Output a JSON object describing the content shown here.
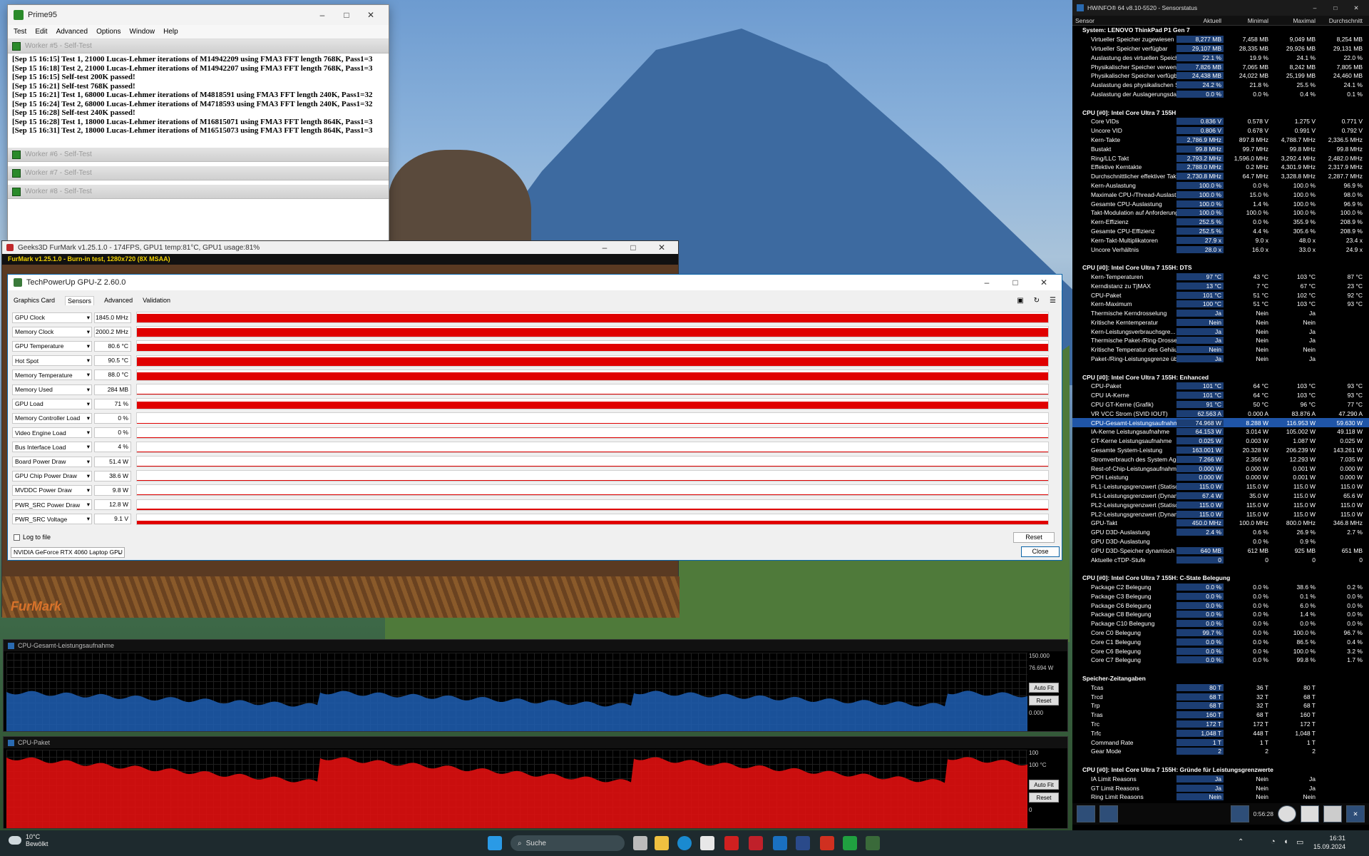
{
  "prime95": {
    "title": "Prime95",
    "menu": [
      "Test",
      "Edit",
      "Advanced",
      "Options",
      "Window",
      "Help"
    ],
    "worker5": "Worker #5 - Self-Test",
    "log": [
      "[Sep 15 16:15] Test 1, 21000 Lucas-Lehmer iterations of M14942209 using FMA3 FFT length 768K, Pass1=3",
      "[Sep 15 16:18] Test 2, 21000 Lucas-Lehmer iterations of M14942207 using FMA3 FFT length 768K, Pass1=3",
      "[Sep 15 16:15] Self-test 200K passed!",
      "[Sep 15 16:21] Self-test 768K passed!",
      "[Sep 15 16:21] Test 1, 68000 Lucas-Lehmer iterations of M4818591 using FMA3 FFT length 240K, Pass1=32",
      "[Sep 15 16:24] Test 2, 68000 Lucas-Lehmer iterations of M4718593 using FMA3 FFT length 240K, Pass1=32",
      "[Sep 15 16:28] Self-test 240K passed!",
      "[Sep 15 16:28] Test 1, 18000 Lucas-Lehmer iterations of M16815071 using FMA3 FFT length 864K, Pass1=3",
      "[Sep 15 16:31] Test 2, 18000 Lucas-Lehmer iterations of M16515073 using FMA3 FFT length 864K, Pass1=3"
    ],
    "workers": [
      "Worker #6 - Self-Test",
      "Worker #7 - Self-Test",
      "Worker #8 - Self-Test"
    ]
  },
  "furmark": {
    "title": "Geeks3D FurMark v1.25.1.0 - 174FPS, GPU1 temp:81°C, GPU1 usage:81%",
    "banner": "FurMark v1.25.1.0 - Burn-in test, 1280x720 (8X MSAA)",
    "logo": "FurMark"
  },
  "gpuz": {
    "title": "TechPowerUp GPU-Z 2.60.0",
    "tabs": [
      "Graphics Card",
      "Sensors",
      "Advanced",
      "Validation"
    ],
    "sensors": [
      {
        "name": "GPU Clock",
        "value": "1845.0 MHz",
        "level": 0.85
      },
      {
        "name": "Memory Clock",
        "value": "2000.2 MHz",
        "level": 0.85
      },
      {
        "name": "GPU Temperature",
        "value": "80.6 °C",
        "level": 0.75
      },
      {
        "name": "Hot Spot",
        "value": "90.5 °C",
        "level": 0.8
      },
      {
        "name": "Memory Temperature",
        "value": "88.0 °C",
        "level": 0.8
      },
      {
        "name": "Memory Used",
        "value": "284 MB",
        "level": 0.0
      },
      {
        "name": "GPU Load",
        "value": "71 %",
        "level": 0.7
      },
      {
        "name": "Memory Controller Load",
        "value": "0 %",
        "level": 0.0
      },
      {
        "name": "Video Engine Load",
        "value": "0 %",
        "level": 0.0
      },
      {
        "name": "Bus Interface Load",
        "value": "4 %",
        "level": 0.05
      },
      {
        "name": "Board Power Draw",
        "value": "51.4 W",
        "level": 0.1
      },
      {
        "name": "GPU Chip Power Draw",
        "value": "38.6 W",
        "level": 0.1
      },
      {
        "name": "MVDDC Power Draw",
        "value": "9.8 W",
        "level": 0.08
      },
      {
        "name": "PWR_SRC Power Draw",
        "value": "12.8 W",
        "level": 0.1
      },
      {
        "name": "PWR_SRC Voltage",
        "value": "9.1 V",
        "level": 0.35
      }
    ],
    "log_to_file": "Log to file",
    "reset": "Reset",
    "close": "Close",
    "gpu_select": "NVIDIA GeForce RTX 4060 Laptop GPU"
  },
  "hwinfo": {
    "title": "HWiNFO® 64 v8.10-5520 - Sensorstatus",
    "columns": [
      "Sensor",
      "Aktuell",
      "Minimal",
      "Maximal",
      "Durchschnitt"
    ],
    "rows": [
      {
        "type": "grp",
        "name": "System: LENOVO ThinkPad P1 Gen 7"
      },
      {
        "name": "Virtueller Speicher zugewiesen",
        "v": [
          "8,277 MB",
          "7,458 MB",
          "9,049 MB",
          "8,254 MB"
        ]
      },
      {
        "name": "Virtueller Speicher verfügbar",
        "v": [
          "29,107 MB",
          "28,335 MB",
          "29,926 MB",
          "29,131 MB"
        ]
      },
      {
        "name": "Auslastung des virtuellen Speichers",
        "v": [
          "22.1 %",
          "19.9 %",
          "24.1 %",
          "22.0 %"
        ]
      },
      {
        "name": "Physikalischer Speicher verwendet",
        "v": [
          "7,826 MB",
          "7,065 MB",
          "8,242 MB",
          "7,805 MB"
        ]
      },
      {
        "name": "Physikalischer Speicher verfügbar",
        "v": [
          "24,438 MB",
          "24,022 MB",
          "25,199 MB",
          "24,460 MB"
        ]
      },
      {
        "name": "Auslastung des physikalischen Sp...",
        "v": [
          "24.2 %",
          "21.8 %",
          "25.5 %",
          "24.1 %"
        ]
      },
      {
        "name": "Auslastung der Auslagerungsdatei",
        "v": [
          "0.0 %",
          "0.0 %",
          "0.4 %",
          "0.1 %"
        ]
      },
      {
        "type": "space"
      },
      {
        "type": "grp",
        "name": "CPU [#0]: Intel Core Ultra 7 155H"
      },
      {
        "name": "Core VIDs",
        "v": [
          "0.836 V",
          "0.578 V",
          "1.275 V",
          "0.771 V"
        ]
      },
      {
        "name": "Uncore VID",
        "v": [
          "0.806 V",
          "0.678 V",
          "0.991 V",
          "0.792 V"
        ]
      },
      {
        "name": "Kern-Takte",
        "v": [
          "2,786.9 MHz",
          "897.8 MHz",
          "4,788.7 MHz",
          "2,336.5 MHz"
        ]
      },
      {
        "name": "Bustakt",
        "v": [
          "99.8 MHz",
          "99.7 MHz",
          "99.8 MHz",
          "99.8 MHz"
        ]
      },
      {
        "name": "Ring/LLC Takt",
        "v": [
          "2,793.2 MHz",
          "1,596.0 MHz",
          "3,292.4 MHz",
          "2,482.0 MHz"
        ]
      },
      {
        "name": "Effektive Kerntakte",
        "v": [
          "2,788.0 MHz",
          "0.2 MHz",
          "4,301.9 MHz",
          "2,317.9 MHz"
        ]
      },
      {
        "name": "Durchschnittlicher effektiver Takt",
        "v": [
          "2,730.8 MHz",
          "64.7 MHz",
          "3,328.8 MHz",
          "2,287.7 MHz"
        ]
      },
      {
        "name": "Kern-Auslastung",
        "v": [
          "100.0 %",
          "0.0 %",
          "100.0 %",
          "96.9 %"
        ]
      },
      {
        "name": "Maximale CPU-/Thread-Auslastung",
        "v": [
          "100.0 %",
          "15.0 %",
          "100.0 %",
          "98.0 %"
        ]
      },
      {
        "name": "Gesamte CPU-Auslastung",
        "v": [
          "100.0 %",
          "1.4 %",
          "100.0 %",
          "96.9 %"
        ]
      },
      {
        "name": "Takt-Modulation auf Anforderung",
        "v": [
          "100.0 %",
          "100.0 %",
          "100.0 %",
          "100.0 %"
        ]
      },
      {
        "name": "Kern-Effizienz",
        "v": [
          "252.5 %",
          "0.0 %",
          "355.9 %",
          "208.9 %"
        ]
      },
      {
        "name": "Gesamte CPU-Effizienz",
        "v": [
          "252.5 %",
          "4.4 %",
          "305.6 %",
          "208.9 %"
        ]
      },
      {
        "name": "Kern-Takt-Multiplikatoren",
        "v": [
          "27.9 x",
          "9.0 x",
          "48.0 x",
          "23.4 x"
        ]
      },
      {
        "name": "Uncore Verhältnis",
        "v": [
          "28.0 x",
          "16.0 x",
          "33.0 x",
          "24.9 x"
        ]
      },
      {
        "type": "space"
      },
      {
        "type": "grp",
        "name": "CPU [#0]: Intel Core Ultra 7 155H: DTS"
      },
      {
        "name": "Kern-Temperaturen",
        "v": [
          "97 °C",
          "43 °C",
          "103 °C",
          "87 °C"
        ]
      },
      {
        "name": "Kerndistanz zu TjMAX",
        "v": [
          "13 °C",
          "7 °C",
          "67 °C",
          "23 °C"
        ]
      },
      {
        "name": "CPU-Paket",
        "v": [
          "101 °C",
          "51 °C",
          "102 °C",
          "92 °C"
        ]
      },
      {
        "name": "Kern-Maximum",
        "v": [
          "100 °C",
          "51 °C",
          "103 °C",
          "93 °C"
        ]
      },
      {
        "name": "Thermische Kerndrosselung",
        "v": [
          "Ja",
          "Nein",
          "Ja",
          ""
        ]
      },
      {
        "name": "Kritische Kerntemperatur",
        "v": [
          "Nein",
          "Nein",
          "Nein",
          ""
        ]
      },
      {
        "name": "Kern-Leistungsverbrauchsgre...",
        "v": [
          "Ja",
          "Nein",
          "Ja",
          ""
        ]
      },
      {
        "name": "Thermische Paket-/Ring-Drosselung",
        "v": [
          "Ja",
          "Nein",
          "Ja",
          ""
        ]
      },
      {
        "name": "Kritische Temperatur des Gehäus...",
        "v": [
          "Nein",
          "Nein",
          "Nein",
          ""
        ]
      },
      {
        "name": "Paket-/Ring-Leistungsgrenze übe...",
        "v": [
          "Ja",
          "Nein",
          "Ja",
          ""
        ]
      },
      {
        "type": "space"
      },
      {
        "type": "grp",
        "name": "CPU [#0]: Intel Core Ultra 7 155H: Enhanced"
      },
      {
        "name": "CPU-Paket",
        "v": [
          "101 °C",
          "64 °C",
          "103 °C",
          "93 °C"
        ]
      },
      {
        "name": "CPU IA-Kerne",
        "v": [
          "101 °C",
          "64 °C",
          "103 °C",
          "93 °C"
        ]
      },
      {
        "name": "CPU GT-Kerne (Grafik)",
        "v": [
          "91 °C",
          "50 °C",
          "96 °C",
          "77 °C"
        ]
      },
      {
        "name": "VR VCC Strom (SVID IOUT)",
        "v": [
          "62.563 A",
          "0.000 A",
          "83.876 A",
          "47.290 A"
        ]
      },
      {
        "type": "sel",
        "name": "CPU-Gesamt-Leistungsaufnahme",
        "v": [
          "74.968 W",
          "8.288 W",
          "116.953 W",
          "59.630 W"
        ]
      },
      {
        "name": "IA-Kerne Leistungsaufnahme",
        "v": [
          "64.153 W",
          "3.014 W",
          "105.002 W",
          "49.118 W"
        ]
      },
      {
        "name": "GT-Kerne Leistungsaufnahme",
        "v": [
          "0.025 W",
          "0.003 W",
          "1.087 W",
          "0.025 W"
        ]
      },
      {
        "name": "Gesamte System-Leistung",
        "v": [
          "163.001 W",
          "20.328 W",
          "206.239 W",
          "143.261 W"
        ]
      },
      {
        "name": "Stromverbrauch des System Agent",
        "v": [
          "7.266 W",
          "2.356 W",
          "12.293 W",
          "7.035 W"
        ]
      },
      {
        "name": "Rest-of-Chip-Leistungsaufnahme",
        "v": [
          "0.000 W",
          "0.000 W",
          "0.001 W",
          "0.000 W"
        ]
      },
      {
        "name": "PCH Leistung",
        "v": [
          "0.000 W",
          "0.000 W",
          "0.001 W",
          "0.000 W"
        ]
      },
      {
        "name": "PL1-Leistungsgrenzwert (Statisch)",
        "v": [
          "115.0 W",
          "115.0 W",
          "115.0 W",
          "115.0 W"
        ]
      },
      {
        "name": "PL1-Leistungsgrenzwert (Dynami...",
        "v": [
          "67.4 W",
          "35.0 W",
          "115.0 W",
          "65.6 W"
        ]
      },
      {
        "name": "PL2-Leistungsgrenzwert (Statisch)",
        "v": [
          "115.0 W",
          "115.0 W",
          "115.0 W",
          "115.0 W"
        ]
      },
      {
        "name": "PL2-Leistungsgrenzwert (Dynami...",
        "v": [
          "115.0 W",
          "115.0 W",
          "115.0 W",
          "115.0 W"
        ]
      },
      {
        "name": "GPU-Takt",
        "v": [
          "450.0 MHz",
          "100.0 MHz",
          "800.0 MHz",
          "346.8 MHz"
        ]
      },
      {
        "name": "GPU D3D-Auslastung",
        "v": [
          "2.4 %",
          "0.6 %",
          "26.9 %",
          "2.7 %"
        ]
      },
      {
        "name": "GPU D3D-Auslastung",
        "v": [
          "",
          "0.0 %",
          "0.9 %",
          ""
        ]
      },
      {
        "name": "GPU D3D-Speicher dynamisch",
        "v": [
          "640 MB",
          "612 MB",
          "925 MB",
          "651 MB"
        ]
      },
      {
        "name": "Aktuelle cTDP-Stufe",
        "v": [
          "0",
          "0",
          "0",
          "0"
        ]
      },
      {
        "type": "space"
      },
      {
        "type": "grp",
        "name": "CPU [#0]: Intel Core Ultra 7 155H: C-State Belegung"
      },
      {
        "name": "Package C2 Belegung",
        "v": [
          "0.0 %",
          "0.0 %",
          "38.6 %",
          "0.2 %"
        ]
      },
      {
        "name": "Package C3 Belegung",
        "v": [
          "0.0 %",
          "0.0 %",
          "0.1 %",
          "0.0 %"
        ]
      },
      {
        "name": "Package C6 Belegung",
        "v": [
          "0.0 %",
          "0.0 %",
          "6.0 %",
          "0.0 %"
        ]
      },
      {
        "name": "Package C8 Belegung",
        "v": [
          "0.0 %",
          "0.0 %",
          "1.4 %",
          "0.0 %"
        ]
      },
      {
        "name": "Package C10 Belegung",
        "v": [
          "0.0 %",
          "0.0 %",
          "0.0 %",
          "0.0 %"
        ]
      },
      {
        "name": "Core C0 Belegung",
        "v": [
          "99.7 %",
          "0.0 %",
          "100.0 %",
          "96.7 %"
        ]
      },
      {
        "name": "Core C1 Belegung",
        "v": [
          "0.0 %",
          "0.0 %",
          "86.5 %",
          "0.4 %"
        ]
      },
      {
        "name": "Core C6 Belegung",
        "v": [
          "0.0 %",
          "0.0 %",
          "100.0 %",
          "3.2 %"
        ]
      },
      {
        "name": "Core C7 Belegung",
        "v": [
          "0.0 %",
          "0.0 %",
          "99.8 %",
          "1.7 %"
        ]
      },
      {
        "type": "space"
      },
      {
        "type": "grp",
        "name": "Speicher-Zeitangaben"
      },
      {
        "name": "Tcas",
        "v": [
          "80 T",
          "36 T",
          "80 T",
          ""
        ]
      },
      {
        "name": "Trcd",
        "v": [
          "68 T",
          "32 T",
          "68 T",
          ""
        ]
      },
      {
        "name": "Trp",
        "v": [
          "68 T",
          "32 T",
          "68 T",
          ""
        ]
      },
      {
        "name": "Tras",
        "v": [
          "160 T",
          "68 T",
          "160 T",
          ""
        ]
      },
      {
        "name": "Trc",
        "v": [
          "172 T",
          "172 T",
          "172 T",
          ""
        ]
      },
      {
        "name": "Trfc",
        "v": [
          "1,048 T",
          "448 T",
          "1,048 T",
          ""
        ]
      },
      {
        "name": "Command Rate",
        "v": [
          "1 T",
          "1 T",
          "1 T",
          ""
        ]
      },
      {
        "name": "Gear Mode",
        "v": [
          "2",
          "2",
          "2",
          ""
        ]
      },
      {
        "type": "space"
      },
      {
        "type": "grp",
        "name": "CPU [#0]: Intel Core Ultra 7 155H: Gründe für Leistungsgrenzwerte"
      },
      {
        "name": "IA Limit Reasons",
        "v": [
          "Ja",
          "Nein",
          "Ja",
          ""
        ]
      },
      {
        "name": "GT Limit Reasons",
        "v": [
          "Ja",
          "Nein",
          "Ja",
          ""
        ]
      },
      {
        "name": "Ring Limit Reasons",
        "v": [
          "Nein",
          "Nein",
          "Nein",
          ""
        ]
      }
    ],
    "timer": "0:56:28"
  },
  "graph1": {
    "title": "CPU-Gesamt-Leistungsaufnahme",
    "top": "150.000",
    "current": "76.694 W",
    "bottom": "0.000",
    "autofit": "Auto Fit",
    "reset": "Reset",
    "color": "#1e5fb4",
    "level": 0.5
  },
  "graph2": {
    "title": "CPU-Paket",
    "top": "100",
    "current": "100 °C",
    "bottom": "0",
    "autofit": "Auto Fit",
    "reset": "Reset",
    "color": "#e01010",
    "level": 0.9
  },
  "taskbar": {
    "weather_temp": "10°C",
    "weather_text": "Bewölkt",
    "search": "Suche",
    "time": "16:31",
    "date": "15.09.2024"
  }
}
